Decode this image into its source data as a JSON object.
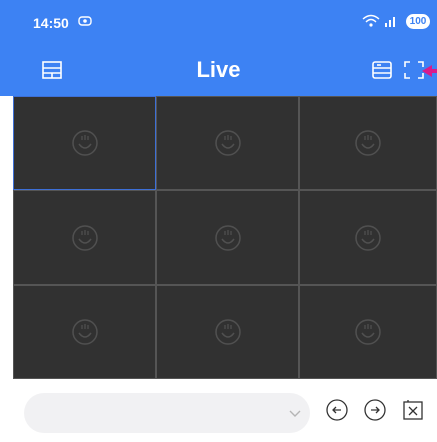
{
  "status_bar": {
    "time": "14:50",
    "battery": "100"
  },
  "header": {
    "title": "Live",
    "accent_color": "#3d82f3"
  },
  "grid": {
    "rows": 3,
    "cols": 3,
    "cells": [
      {
        "selected": true
      },
      {
        "selected": false
      },
      {
        "selected": false
      },
      {
        "selected": false
      },
      {
        "selected": false
      },
      {
        "selected": false
      },
      {
        "selected": false
      },
      {
        "selected": false
      },
      {
        "selected": false
      }
    ]
  },
  "bottom_bar": {
    "dropdown_value": "",
    "icons": [
      "chevron-down-icon",
      "previous-icon",
      "next-icon",
      "close-all-icon"
    ]
  }
}
